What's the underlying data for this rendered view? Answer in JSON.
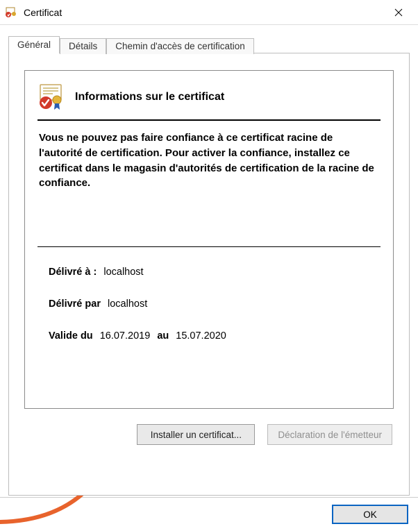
{
  "window": {
    "title": "Certificat"
  },
  "tabs": {
    "general": "Général",
    "details": "Détails",
    "certpath": "Chemin d'accès de certification"
  },
  "cert": {
    "heading": "Informations sur le certificat",
    "warning": "Vous ne pouvez pas faire confiance à ce certificat racine de l'autorité de certification. Pour activer la confiance, installez ce certificat dans le magasin d'autorités de certification de la racine de confiance.",
    "issued_to_label": "Délivré à :",
    "issued_to_value": "localhost",
    "issued_by_label": "Délivré par",
    "issued_by_value": "localhost",
    "valid_from_label": "Valide du",
    "valid_from_value": "16.07.2019",
    "valid_to_label": "au",
    "valid_to_value": "15.07.2020"
  },
  "buttons": {
    "install": "Installer un certificat...",
    "issuer_statement": "Déclaration de l'émetteur",
    "ok": "OK"
  }
}
